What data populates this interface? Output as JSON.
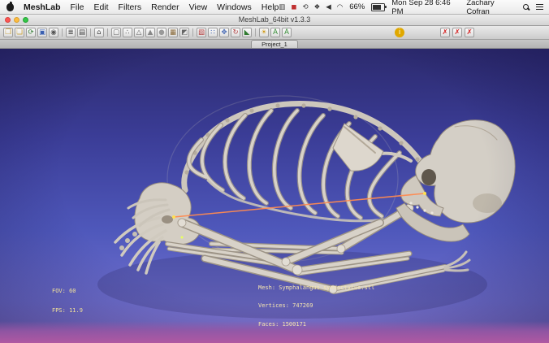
{
  "menu_bar": {
    "app_name": "MeshLab",
    "items": [
      "File",
      "Edit",
      "Filters",
      "Render",
      "View",
      "Windows",
      "Help"
    ],
    "status_icons": [
      {
        "name": "display-icon",
        "glyph": "▥",
        "color": "#333333"
      },
      {
        "name": "keyboard-layout-icon",
        "glyph": "◼",
        "color": "#c03030"
      },
      {
        "name": "time-machine-icon",
        "glyph": "⟲",
        "color": "#333333"
      },
      {
        "name": "bluetooth-icon",
        "glyph": "❖",
        "color": "#333333"
      },
      {
        "name": "volume-icon",
        "glyph": "◀",
        "color": "#333333"
      },
      {
        "name": "wifi-icon",
        "glyph": "◠",
        "color": "#333333"
      }
    ],
    "battery_label": "66%",
    "datetime": "Mon Sep 28 6:46 PM",
    "user_name": "Zachary Cofran"
  },
  "window": {
    "title": "MeshLab_64bit v1.3.3",
    "tab_label": "Project_1",
    "toolbar": {
      "main": [
        {
          "name": "open-project-icon",
          "glyph": "❐",
          "color": "#c89a28"
        },
        {
          "name": "open-mesh-icon",
          "glyph": "❏",
          "color": "#c89a28"
        },
        {
          "name": "reload-mesh-icon",
          "glyph": "⟳",
          "color": "#2f7a2f"
        },
        {
          "name": "save-mesh-icon",
          "glyph": "▣",
          "color": "#3a5fb0"
        },
        {
          "name": "save-snapshot-icon",
          "glyph": "◉",
          "color": "#555555"
        },
        {
          "name": "layers-dialog-icon",
          "glyph": "≣",
          "color": "#444444",
          "sep": true
        },
        {
          "name": "raster-layers-icon",
          "glyph": "▤",
          "color": "#444444"
        },
        {
          "name": "home-view-icon",
          "glyph": "⌂",
          "color": "#444444",
          "sep": true
        },
        {
          "name": "bounding-box-icon",
          "glyph": "▢",
          "color": "#666666",
          "sep": true
        },
        {
          "name": "points-mode-icon",
          "glyph": "∴",
          "color": "#666666"
        },
        {
          "name": "wireframe-mode-icon",
          "glyph": "△",
          "color": "#666666"
        },
        {
          "name": "flat-shading-icon",
          "glyph": "▲",
          "color": "#888888"
        },
        {
          "name": "smooth-shading-icon",
          "glyph": "●",
          "color": "#999999"
        },
        {
          "name": "texture-mode-icon",
          "glyph": "▦",
          "color": "#8a6a3a"
        },
        {
          "name": "backface-cull-icon",
          "glyph": "◩",
          "color": "#666666"
        },
        {
          "name": "select-faces-icon",
          "glyph": "▧",
          "color": "#b03a3a",
          "sep": true
        },
        {
          "name": "select-vertices-icon",
          "glyph": "∷",
          "color": "#3a5fb0"
        },
        {
          "name": "translate-tool-icon",
          "glyph": "✥",
          "color": "#3a5fb0"
        },
        {
          "name": "rotate-tool-icon",
          "glyph": "↻",
          "color": "#b03a3a"
        },
        {
          "name": "scale-tool-icon",
          "glyph": "◣",
          "color": "#2f7a2f"
        },
        {
          "name": "lighting-toggle-icon",
          "glyph": "☀",
          "color": "#d09a18",
          "sep": true
        },
        {
          "name": "quality-mapper-icon",
          "glyph": "A",
          "color": "#2f8a2f"
        },
        {
          "name": "texture-parametrization-icon",
          "glyph": "A",
          "color": "#2f8a2f"
        }
      ],
      "info": {
        "name": "layer-info-icon",
        "glyph": "i",
        "color": "#ffffff",
        "bg": "#e0a800",
        "round": true
      },
      "deletes": [
        {
          "name": "delete-mesh-icon",
          "glyph": "✗",
          "color": "#d42020"
        },
        {
          "name": "delete-raster-icon",
          "glyph": "✗",
          "color": "#d42020"
        },
        {
          "name": "delete-all-icon",
          "glyph": "✗",
          "color": "#d42020"
        }
      ]
    }
  },
  "viewport": {
    "hud_fov": "FOV: 60",
    "hud_fps": "FPS: 11.9",
    "mesh_info_lines": [
      "Mesh: Symphalangus syndactylus.stl",
      "Vertices: 747269",
      "Faces: 1500171"
    ],
    "colors": {
      "background_top": "#2c2a6e",
      "background_bottom": "#8371c6",
      "bottom_strip": "#b058a2",
      "hud_text": "#f2e29a",
      "measure_line": "#ff8a50",
      "bone": "#d4cfc6"
    }
  }
}
